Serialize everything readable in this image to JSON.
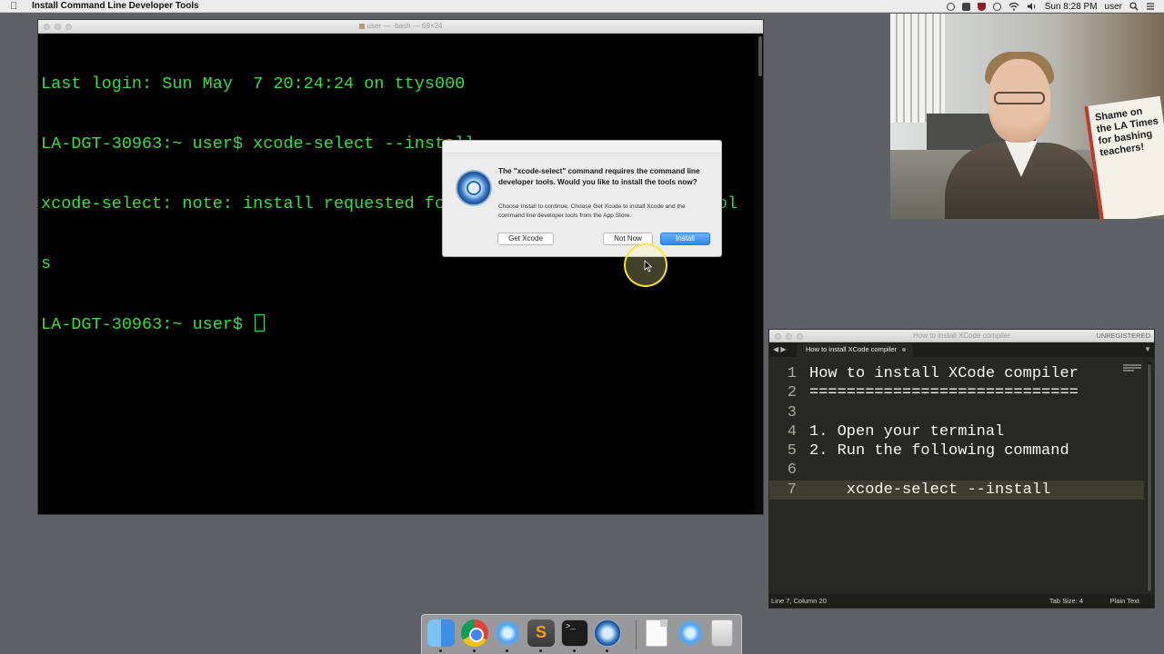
{
  "menubar": {
    "app_title": "Install Command Line Developer Tools",
    "clock": "Sun 8:28 PM",
    "user": "user",
    "icons": [
      "apple-icon",
      "record-icon",
      "square-icon",
      "shield-icon",
      "circle-icon",
      "wifi-icon",
      "volume-icon",
      "search-icon",
      "list-icon"
    ]
  },
  "terminal": {
    "title": "user — -bash — 69×24",
    "lines": [
      "Last login: Sun May  7 20:24:24 on ttys000",
      "LA-DGT-30963:~ user$ xcode-select --install",
      "xcode-select: note: install requested for command line developer tool",
      "s",
      "LA-DGT-30963:~ user$ "
    ],
    "text_color": "#34e03f"
  },
  "dialog": {
    "heading": "The \"xcode-select\" command requires the command line developer tools. Would you like to install the tools now?",
    "body": "Choose Install to continue. Choose Get Xcode to install Xcode and the command line developer tools from the App Store.",
    "buttons": {
      "get_xcode": "Get Xcode",
      "not_now": "Not Now",
      "install": "Install"
    },
    "accent": "#2d86f0"
  },
  "webcam": {
    "sign_text": "Shame on the LA Times for bashing teachers!"
  },
  "editor": {
    "title": "How to install XCode compiler",
    "unregistered": "UNREGISTERED",
    "tab_label": "How to install XCode compiler",
    "lines": [
      {
        "num": "1",
        "text": "How to install XCode compiler"
      },
      {
        "num": "2",
        "text": "============================="
      },
      {
        "num": "3",
        "text": ""
      },
      {
        "num": "4",
        "text": "1. Open your terminal"
      },
      {
        "num": "5",
        "text": "2. Run the following command"
      },
      {
        "num": "6",
        "text": ""
      },
      {
        "num": "7",
        "text": "    xcode-select --install"
      }
    ],
    "status": {
      "position": "Line 7, Column 20",
      "tab_size": "Tab Size: 4",
      "syntax": "Plain Text"
    }
  },
  "dock": {
    "items": [
      "finder-icon",
      "chrome-icon",
      "siri-icon",
      "sublime-text-icon",
      "terminal-icon",
      "installer-icon",
      "document-icon",
      "siri-icon",
      "trash-icon"
    ]
  }
}
